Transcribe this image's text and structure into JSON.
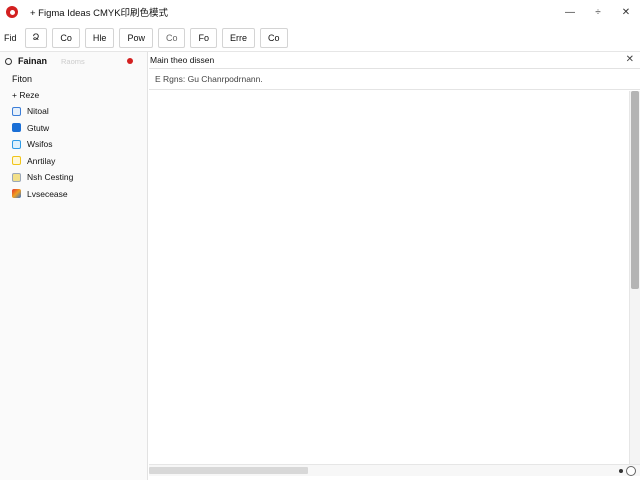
{
  "window": {
    "title": "+ Figma Ideas CMYK印刷色模式",
    "minimize": "—",
    "restore": "÷",
    "close": "✕"
  },
  "toolbar": {
    "label": "Fid",
    "buttons": [
      "Ձ",
      "Co",
      "Hle",
      "Pow",
      "Co",
      "Fo",
      "Erre",
      "Co"
    ]
  },
  "sidebar": {
    "title": "Fainan",
    "subtitle": "Raoms",
    "section": "Fiton",
    "group": "+ Reze",
    "items": [
      {
        "label": "Nitoal",
        "icon": "app-icon",
        "color": "#3b7dd8"
      },
      {
        "label": "Gtutw",
        "icon": "app-icon",
        "color": "#1a6fd6"
      },
      {
        "label": "Wsifos",
        "icon": "app-icon",
        "color": "#2f9be6"
      },
      {
        "label": "Anrtilay",
        "icon": "app-icon",
        "color": "#f0c419"
      },
      {
        "label": "Nsh Cesting",
        "icon": "app-icon",
        "color": "#e8c830"
      },
      {
        "label": "Lvsecease",
        "icon": "app-icon",
        "color": "#e07020"
      }
    ]
  },
  "main": {
    "title": "Main theo dissen",
    "info": "E Rgns: Gu Chanrpodrnann.",
    "close": "✕"
  },
  "colors": {
    "accent_red": "#d32020"
  }
}
